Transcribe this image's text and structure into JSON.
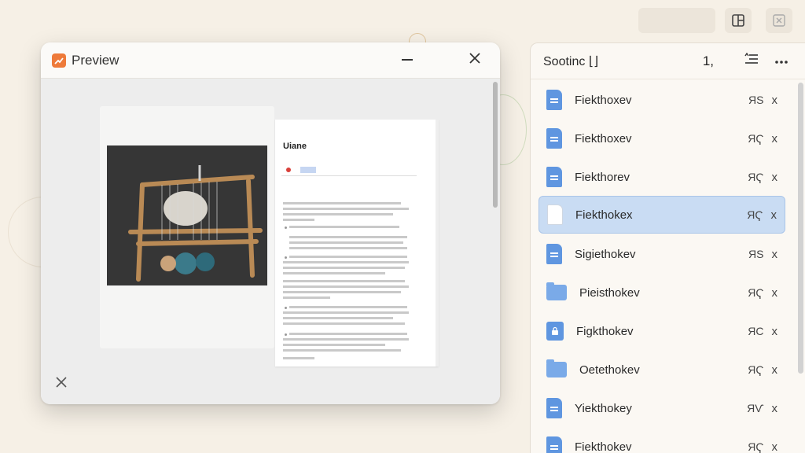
{
  "preview": {
    "title": "Preview",
    "document_title": "Uiane",
    "minimize_icon": "minimize-icon",
    "close_icon": "close-icon"
  },
  "side_panel": {
    "title": "Sootinc ⌊⌋",
    "page_indicator": "1,",
    "items": [
      {
        "name": "Fiekthoxev",
        "size": "ЯS",
        "icon": "file-icon"
      },
      {
        "name": "Fiekthoxev",
        "size": "ЯҀ",
        "icon": "file-icon"
      },
      {
        "name": "Fiekthorev",
        "size": "ЯҀ",
        "icon": "file-icon"
      },
      {
        "name": "Fiekthokex",
        "size": "ЯҀ",
        "icon": "blank-file-icon",
        "selected": true
      },
      {
        "name": "Sigiethokev",
        "size": "ЯS",
        "icon": "file-icon"
      },
      {
        "name": "Pieisthokev",
        "size": "ЯҀ",
        "icon": "folder-icon"
      },
      {
        "name": "Figkthokev",
        "size": "ЯC",
        "icon": "lock-file-icon"
      },
      {
        "name": "Oetethokev",
        "size": "ЯҀ",
        "icon": "folder-icon"
      },
      {
        "name": "Yiekthokey",
        "size": "ЯѴ",
        "icon": "file-icon"
      },
      {
        "name": "Fiekthokev",
        "size": "ЯҀ",
        "icon": "file-icon"
      }
    ],
    "remove_glyph": "x"
  },
  "colors": {
    "accent": "#5f96e0",
    "selected_bg": "#c9dcf3",
    "app_icon": "#ee7a3a",
    "background": "#f6f0e6"
  }
}
